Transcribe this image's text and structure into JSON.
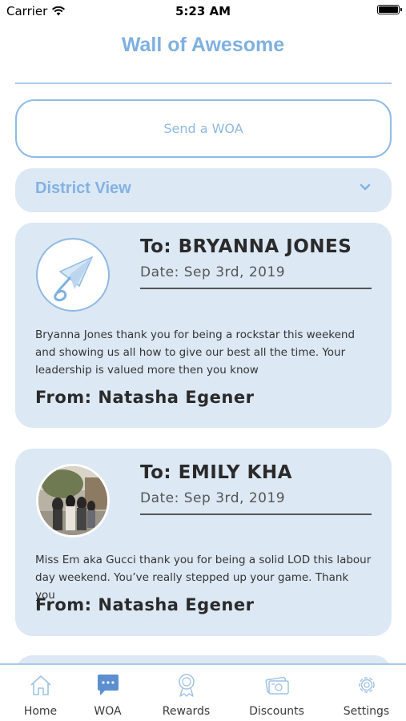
{
  "status_bar": {
    "carrier": "Carrier",
    "time": "5:23 AM"
  },
  "header": {
    "title": "Wall of Awesome"
  },
  "actions": {
    "send_label": "Send a WOA"
  },
  "filter": {
    "label": "District View"
  },
  "cards": [
    {
      "to": "To: BRYANNA JONES",
      "date": "Date: Sep 3rd, 2019",
      "message": "Bryanna Jones thank you for being a rockstar this weekend and showing us all how to give our best all the time. Your leadership is valued more then you know",
      "from": "From: Natasha Egener"
    },
    {
      "to": "To: EMILY KHA",
      "date": "Date: Sep 3rd, 2019",
      "message": "Miss Em aka Gucci thank you for being a solid LOD this labour day weekend. You’ve really stepped up your game. Thank you",
      "from": "From: Natasha Egener"
    }
  ],
  "tabs": [
    {
      "label": "Home",
      "icon": "home-icon"
    },
    {
      "label": "WOA",
      "icon": "chat-icon",
      "active": true
    },
    {
      "label": "Rewards",
      "icon": "award-icon"
    },
    {
      "label": "Discounts",
      "icon": "discount-card-icon"
    },
    {
      "label": "Settings",
      "icon": "gear-icon"
    }
  ],
  "colors": {
    "accent": "#7fb0e0",
    "card_bg": "#dce8f4",
    "border": "#8fbbe6"
  }
}
